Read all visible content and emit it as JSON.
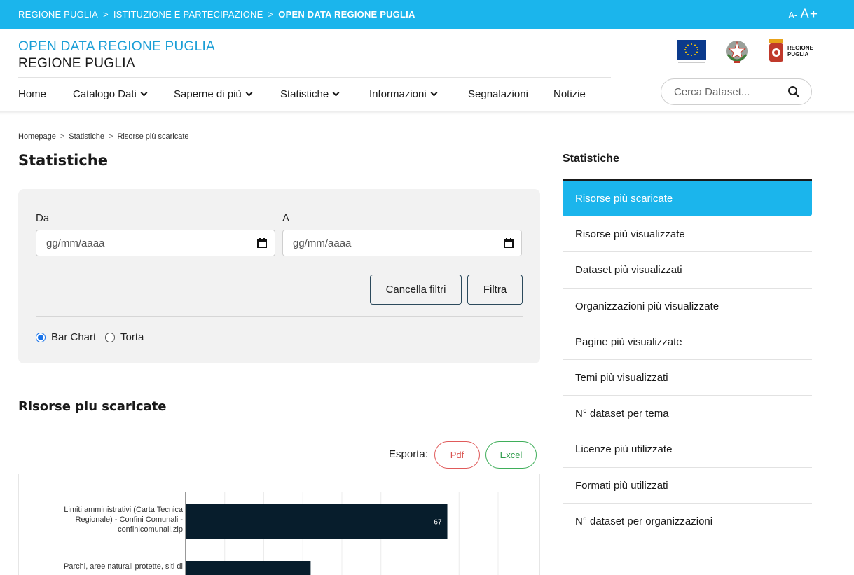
{
  "topbar": {
    "crumbs": [
      "REGIONE PUGLIA",
      "ISTITUZIONE E PARTECIPAZIONE",
      "OPEN DATA REGIONE PUGLIA"
    ],
    "separator": ">",
    "font_small": "A",
    "font_minus": "-",
    "font_big": "A",
    "font_plus": "+"
  },
  "header": {
    "title": "OPEN DATA REGIONE PUGLIA",
    "subtitle": "REGIONE PUGLIA",
    "logo_rp_line1": "REGIONE",
    "logo_rp_line2": "PUGLIA"
  },
  "nav": {
    "items": [
      {
        "label": "Home"
      },
      {
        "label": "Catalogo Dati"
      },
      {
        "label": "Saperne di più"
      },
      {
        "label": "Statistiche"
      },
      {
        "label": "Informazioni"
      },
      {
        "label": "Segnalazioni"
      },
      {
        "label": "Notizie"
      }
    ],
    "search_placeholder": "Cerca Dataset..."
  },
  "breadcrumb": {
    "items": [
      "Homepage",
      "Statistiche",
      "Risorse più scaricate"
    ],
    "separator": ">"
  },
  "page": {
    "title": "Statistiche"
  },
  "filters": {
    "from_label": "Da",
    "to_label": "A",
    "from_placeholder": "gg/mm/aaaa",
    "to_placeholder": "gg/mm/aaaa",
    "clear_label": "Cancella filtri",
    "filter_label": "Filtra",
    "chart_options": [
      "Bar Chart",
      "Torta"
    ],
    "selected_chart": "Bar Chart"
  },
  "results": {
    "title": "Risorse piu scaricate",
    "export_label": "Esporta:",
    "pdf_label": "Pdf",
    "excel_label": "Excel"
  },
  "chart_data": {
    "type": "bar",
    "orientation": "horizontal",
    "categories": [
      "Limiti amministrativi (Carta Tecnica Regionale) - Confini Comunali - confinicomunali.zip",
      "Parchi, aree naturali protette, siti di"
    ],
    "category_lines": [
      [
        "Limiti amministrativi (Carta Tecnica",
        "Regionale) - Confini Comunali -",
        "confinicomunali.zip"
      ],
      [
        "Parchi, aree naturali protette, siti di"
      ]
    ],
    "values": [
      67,
      32
    ],
    "value_labels": [
      "67",
      ""
    ],
    "bar_color": "#071d2c",
    "xlim": [
      0,
      80
    ],
    "grid": true
  },
  "sidebar": {
    "title": "Statistiche",
    "items": [
      {
        "label": "Risorse più scaricate",
        "active": true
      },
      {
        "label": "Risorse più visualizzate",
        "active": false
      },
      {
        "label": "Dataset più visualizzati",
        "active": false
      },
      {
        "label": "Organizzazioni più visualizzate",
        "active": false
      },
      {
        "label": "Pagine più visualizzate",
        "active": false
      },
      {
        "label": "Temi più visualizzati",
        "active": false
      },
      {
        "label": "N° dataset per tema",
        "active": false
      },
      {
        "label": "Licenze più utilizzate",
        "active": false
      },
      {
        "label": "Formati più utilizzati",
        "active": false
      },
      {
        "label": "N° dataset per organizzazioni",
        "active": false
      }
    ]
  },
  "colors": {
    "accent": "#1bb5ec",
    "title_blue": "#1a9ed6",
    "panel_bg": "#f2f2f2"
  }
}
